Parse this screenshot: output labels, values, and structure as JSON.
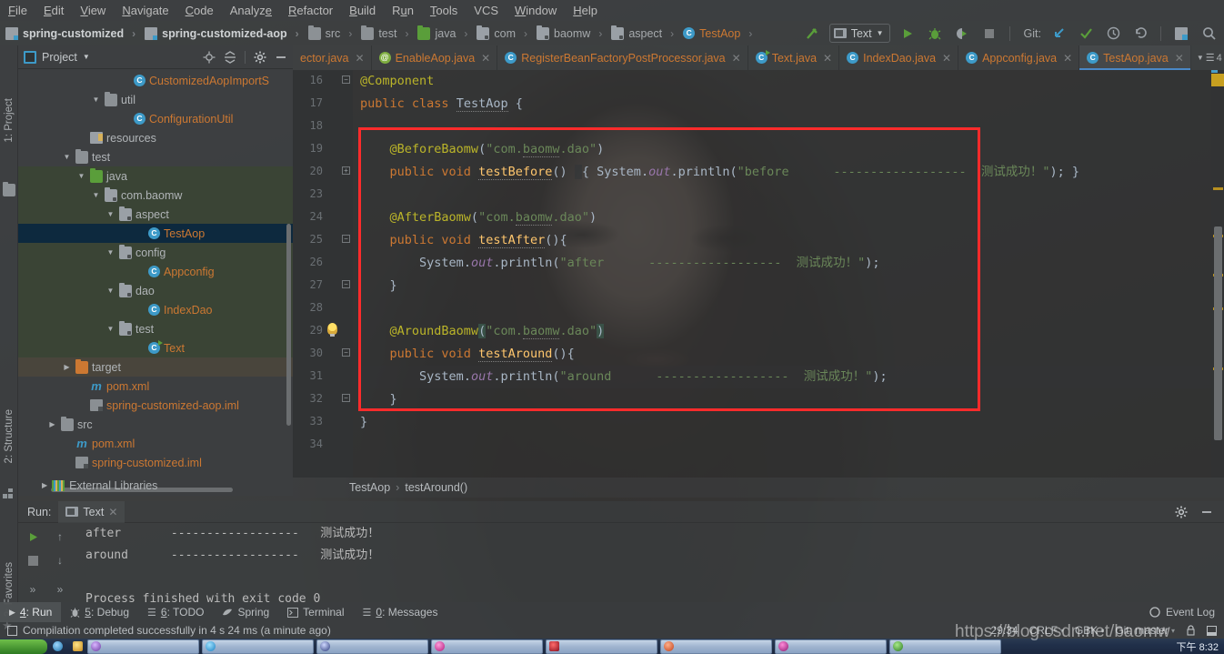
{
  "menubar": {
    "items": [
      "File",
      "Edit",
      "View",
      "Navigate",
      "Code",
      "Analyze",
      "Refactor",
      "Build",
      "Run",
      "Tools",
      "VCS",
      "Window",
      "Help"
    ]
  },
  "navbar": {
    "crumbs": [
      "spring-customized",
      "spring-customized-aop",
      "src",
      "test",
      "java",
      "com",
      "baomw",
      "aspect",
      "TestAop"
    ],
    "run_config": "Text",
    "git_label": "Git:"
  },
  "tabs": [
    {
      "label": "ector.java",
      "icon": "class-icon",
      "active": false
    },
    {
      "label": "EnableAop.java",
      "icon": "annotation-icon",
      "active": false
    },
    {
      "label": "RegisterBeanFactoryPostProcessor.java",
      "icon": "class-icon",
      "active": false
    },
    {
      "label": "Text.java",
      "icon": "runnable-class-icon",
      "active": false
    },
    {
      "label": "IndexDao.java",
      "icon": "class-icon",
      "active": false
    },
    {
      "label": "Appconfig.java",
      "icon": "class-icon",
      "active": false
    },
    {
      "label": "TestAop.java",
      "icon": "class-icon",
      "active": true
    }
  ],
  "tab_overflow_count": "4",
  "sidebar": {
    "title": "Project",
    "vertical_label": "1: Project",
    "structure_label": "2: Structure",
    "favorites_label": "2: Favorites",
    "tree": [
      {
        "label": "CustomizedAopImportS",
        "icon": "class-icon",
        "indent": 7,
        "arrow": "",
        "type": "cls",
        "bg": ""
      },
      {
        "label": "util",
        "icon": "folder-icon",
        "indent": 5,
        "arrow": "▼",
        "type": "dir",
        "bg": ""
      },
      {
        "label": "ConfigurationUtil",
        "icon": "class-icon",
        "indent": 7,
        "arrow": "",
        "type": "cls",
        "bg": ""
      },
      {
        "label": "resources",
        "icon": "resources-folder-icon",
        "indent": 4,
        "arrow": "",
        "type": "dir",
        "bg": ""
      },
      {
        "label": "test",
        "icon": "folder-icon",
        "indent": 3,
        "arrow": "▼",
        "type": "dir",
        "bg": ""
      },
      {
        "label": "java",
        "icon": "source-folder-icon",
        "indent": 4,
        "arrow": "▼",
        "type": "dir",
        "bg": "green"
      },
      {
        "label": "com.baomw",
        "icon": "package-icon",
        "indent": 5,
        "arrow": "▼",
        "type": "dir",
        "bg": "green"
      },
      {
        "label": "aspect",
        "icon": "package-icon",
        "indent": 6,
        "arrow": "▼",
        "type": "dir",
        "bg": "green"
      },
      {
        "label": "TestAop",
        "icon": "class-icon",
        "indent": 8,
        "arrow": "",
        "type": "cls",
        "bg": "selected"
      },
      {
        "label": "config",
        "icon": "package-icon",
        "indent": 6,
        "arrow": "▼",
        "type": "dir",
        "bg": "green"
      },
      {
        "label": "Appconfig",
        "icon": "class-icon",
        "indent": 8,
        "arrow": "",
        "type": "cls",
        "bg": "green"
      },
      {
        "label": "dao",
        "icon": "package-icon",
        "indent": 6,
        "arrow": "▼",
        "type": "dir",
        "bg": "green"
      },
      {
        "label": "IndexDao",
        "icon": "class-icon",
        "indent": 8,
        "arrow": "",
        "type": "cls",
        "bg": "green"
      },
      {
        "label": "test",
        "icon": "package-icon",
        "indent": 6,
        "arrow": "▼",
        "type": "dir",
        "bg": "green"
      },
      {
        "label": "Text",
        "icon": "runnable-class-icon",
        "indent": 8,
        "arrow": "",
        "type": "cls",
        "bg": "green"
      },
      {
        "label": "target",
        "icon": "target-folder-icon",
        "indent": 3,
        "arrow": "▶",
        "type": "dir",
        "bg": "brown"
      },
      {
        "label": "pom.xml",
        "icon": "maven-icon",
        "indent": 4,
        "arrow": "",
        "type": "xml",
        "bg": ""
      },
      {
        "label": "spring-customized-aop.iml",
        "icon": "iml-icon",
        "indent": 4,
        "arrow": "",
        "type": "xml",
        "bg": ""
      },
      {
        "label": "src",
        "icon": "folder-icon",
        "indent": 2,
        "arrow": "▶",
        "type": "dir",
        "bg": ""
      },
      {
        "label": "pom.xml",
        "icon": "maven-icon",
        "indent": 3,
        "arrow": "",
        "type": "xml",
        "bg": ""
      },
      {
        "label": "spring-customized.iml",
        "icon": "iml-icon",
        "indent": 3,
        "arrow": "",
        "type": "xml",
        "bg": ""
      }
    ],
    "external_libraries": "External Libraries"
  },
  "editor": {
    "line_numbers": [
      "16",
      "17",
      "18",
      "19",
      "20",
      "23",
      "24",
      "25",
      "26",
      "27",
      "28",
      "29",
      "30",
      "31",
      "32",
      "33",
      "34"
    ],
    "current_line": "29",
    "lines": [
      "@Component",
      "public class TestAop {",
      "",
      "    @BeforeBaomw(\"com.baomw.dao\")",
      "    public void testBefore() { System.out.println(\"before      ------------------  测试成功！\"); }",
      "",
      "    @AfterBaomw(\"com.baomw.dao\")",
      "    public void testAfter(){",
      "        System.out.println(\"after      ------------------  测试成功！\");",
      "    }",
      "",
      "    @AroundBaomw(\"com.baomw.dao\")",
      "    public void testAround(){",
      "        System.out.println(\"around      ------------------  测试成功！\");",
      "    }",
      "}",
      ""
    ],
    "breadcrumb": [
      "TestAop",
      "testAround()"
    ]
  },
  "run_panel": {
    "run_label": "Run:",
    "tab_label": "Text",
    "console_lines": [
      "after       ------------------   测试成功！",
      "around      ------------------   测试成功！",
      "",
      "Process finished with exit code 0"
    ]
  },
  "bottom_strip": {
    "items": [
      {
        "label": "4: Run",
        "underline": "4",
        "icon": "run-icon",
        "active": true
      },
      {
        "label": "5: Debug",
        "underline": "5",
        "icon": "debug-icon",
        "active": false
      },
      {
        "label": "6: TODO",
        "underline": "6",
        "icon": "todo-icon",
        "active": false
      },
      {
        "label": "Spring",
        "underline": "",
        "icon": "spring-icon",
        "active": false
      },
      {
        "label": "Terminal",
        "underline": "",
        "icon": "terminal-icon",
        "active": false
      },
      {
        "label": "0: Messages",
        "underline": "0",
        "icon": "messages-icon",
        "active": false
      }
    ],
    "event_log": "Event Log"
  },
  "statusbar": {
    "message": "Compilation completed successfully in 4 s 24 ms (a minute ago)",
    "caret_position": "29:34",
    "line_separator": "CRLF",
    "encoding": "GBK",
    "git_branch": "Git: master"
  },
  "watermark": "https://blog.csdn.net/baomw",
  "taskbar": {
    "clock": "下午 8:32"
  },
  "colors": {
    "accent_blue": "#4a88c7",
    "keyword_orange": "#cc7832",
    "string_green": "#6a8759",
    "annotation_yellow": "#bbb529",
    "red_box": "#ff2b2b",
    "selection_blue": "#0d293e"
  }
}
